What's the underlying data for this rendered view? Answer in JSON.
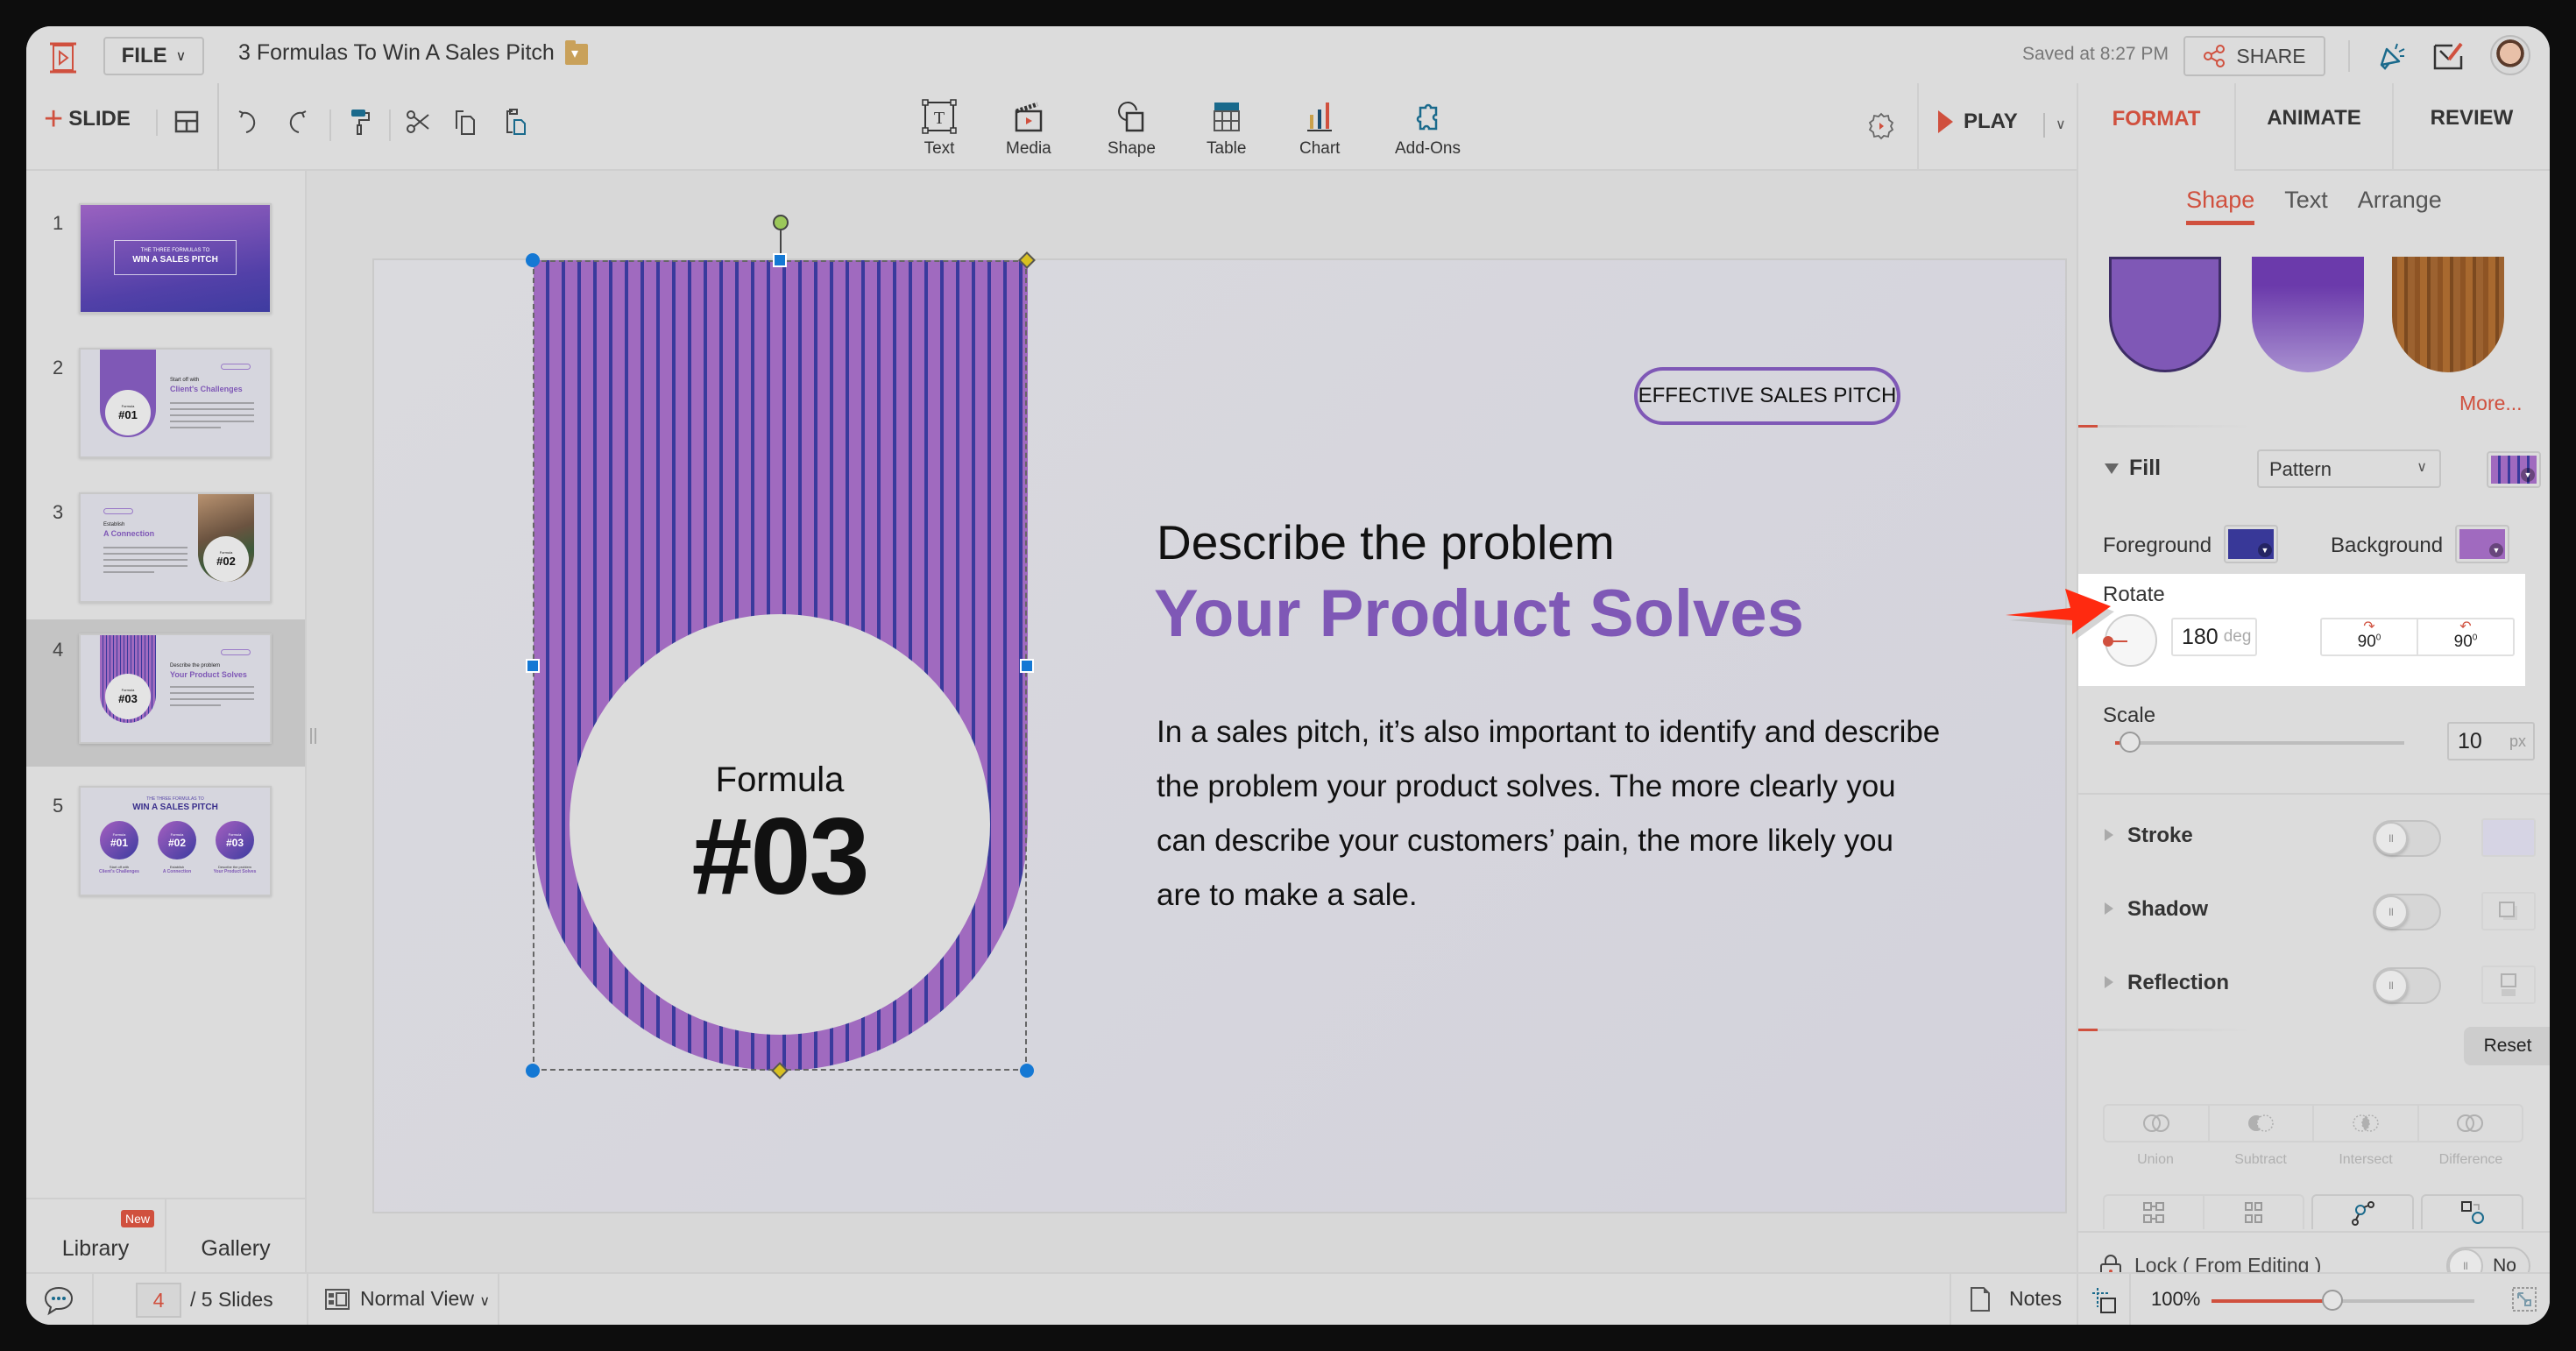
{
  "header": {
    "file_label": "FILE",
    "doc_title": "3 Formulas To Win A Sales Pitch",
    "saved_status": "Saved at 8:27 PM",
    "share_label": "SHARE"
  },
  "toolbar": {
    "slide_label": "SLIDE",
    "insert": [
      {
        "label": "Text",
        "icon": "text-box-icon"
      },
      {
        "label": "Media",
        "icon": "clapperboard-icon"
      },
      {
        "label": "Shape",
        "icon": "shape-icon"
      },
      {
        "label": "Table",
        "icon": "table-icon"
      },
      {
        "label": "Chart",
        "icon": "bar-chart-icon"
      },
      {
        "label": "Add-Ons",
        "icon": "puzzle-icon"
      }
    ],
    "play_label": "PLAY"
  },
  "right_panel": {
    "tabs": [
      "FORMAT",
      "ANIMATE",
      "REVIEW"
    ],
    "active_tab": "FORMAT",
    "subtabs": [
      "Shape",
      "Text",
      "Arrange"
    ],
    "active_subtab": "Shape",
    "more_label": "More...",
    "fill": {
      "label": "Fill",
      "type": "Pattern",
      "foreground_label": "Foreground",
      "foreground_color": "#383898",
      "background_label": "Background",
      "background_color": "#a06abf"
    },
    "rotate": {
      "label": "Rotate",
      "value": "180",
      "unit": "deg",
      "rotate_cw_label": "90",
      "rotate_ccw_label": "90"
    },
    "scale": {
      "label": "Scale",
      "value": "10",
      "unit": "px",
      "slider_fraction": 0.05
    },
    "properties": [
      {
        "label": "Stroke",
        "enabled": false
      },
      {
        "label": "Shadow",
        "enabled": false
      },
      {
        "label": "Reflection",
        "enabled": false
      }
    ],
    "reset_label": "Reset",
    "boolean_ops": [
      "Union",
      "Subtract",
      "Intersect",
      "Difference"
    ],
    "lock": {
      "label": "Lock ( From Editing )",
      "value": "No"
    }
  },
  "left_panel": {
    "slides": [
      {
        "number": "1",
        "subtitle": "THE THREE FORMULAS TO",
        "title": "WIN A SALES PITCH"
      },
      {
        "number": "2",
        "h1": "Start off with",
        "h2": "Client's Challenges",
        "badge": "#01",
        "caption": "Formula"
      },
      {
        "number": "3",
        "h1": "Establish",
        "h2": "A Connection",
        "badge": "#02",
        "caption": "Formula"
      },
      {
        "number": "4",
        "h1": "Describe the problem",
        "h2": "Your Product Solves",
        "badge": "#03",
        "caption": "Formula"
      },
      {
        "number": "5",
        "subtitle": "THE THREE FORMULAS TO",
        "title": "WIN A SALES PITCH",
        "items": [
          {
            "badge": "#01",
            "caption": "Formula",
            "h1": "Start off with",
            "h2": "Client's Challenges"
          },
          {
            "badge": "#02",
            "caption": "Formula",
            "h1": "Establish",
            "h2": "A Connection"
          },
          {
            "badge": "#03",
            "caption": "Formula",
            "h1": "Describe the problem",
            "h2": "Your Product Solves"
          }
        ]
      }
    ],
    "selected_slide": "4",
    "library_label": "Library",
    "library_badge": "New",
    "gallery_label": "Gallery"
  },
  "slide": {
    "pill": "EFFECTIVE SALES PITCH",
    "formula_label": "Formula",
    "formula_number": "#03",
    "heading1": "Describe the problem",
    "heading2": "Your Product Solves",
    "body": "In a sales pitch, it’s also important to identify and describe the problem your product solves. The more clearly you can describe your customers’ pain, the more likely you are to make a sale.",
    "accent_color": "#7f58b6"
  },
  "statusbar": {
    "current_page": "4",
    "total_pages": "/ 5 Slides",
    "view_mode": "Normal View",
    "notes_label": "Notes",
    "zoom_label": "100%",
    "zoom_fraction": 0.46
  }
}
